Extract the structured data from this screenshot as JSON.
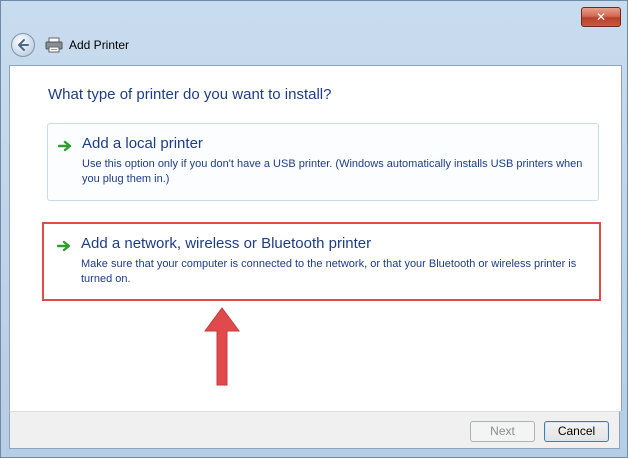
{
  "window": {
    "title": "Add Printer",
    "close_label": "✕"
  },
  "main": {
    "heading": "What type of printer do you want to install?",
    "options": [
      {
        "title": "Add a local printer",
        "description": "Use this option only if you don't have a USB printer. (Windows automatically installs USB printers when you plug them in.)",
        "icon": "green-arrow-icon"
      },
      {
        "title": "Add a network, wireless or Bluetooth printer",
        "description": "Make sure that your computer is connected to the network, or that your Bluetooth or wireless printer is turned on.",
        "icon": "green-arrow-icon"
      }
    ]
  },
  "footer": {
    "next_label": "Next",
    "cancel_label": "Cancel"
  },
  "colors": {
    "heading_blue": "#1e3d87",
    "highlight_red": "#e04a4a",
    "arrow_green": "#2f9e2f"
  }
}
